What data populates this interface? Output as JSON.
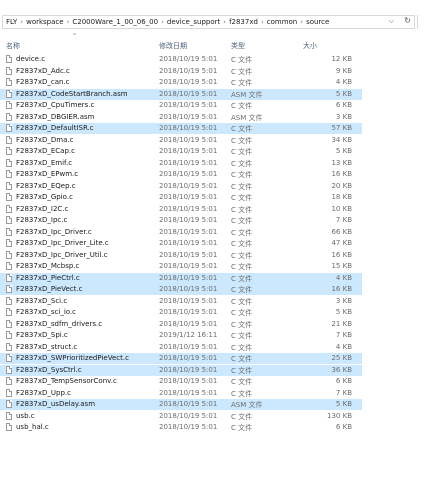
{
  "address": {
    "crumbs": [
      "FLY",
      "workspace",
      "C2000Ware_1_00_06_00",
      "device_support",
      "f2837xd",
      "common",
      "source"
    ],
    "dropdown_icon": "chevron-down-icon",
    "refresh_icon": "refresh-icon"
  },
  "columns": {
    "name": "名称",
    "date": "修改日期",
    "type": "类型",
    "size": "大小"
  },
  "files": [
    {
      "name": "device.c",
      "date": "2018/10/19 5:01",
      "type": "C 文件",
      "size": "12 KB",
      "selected": false
    },
    {
      "name": "F2837xD_Adc.c",
      "date": "2018/10/19 5:01",
      "type": "C 文件",
      "size": "9 KB",
      "selected": false
    },
    {
      "name": "F2837xD_can.c",
      "date": "2018/10/19 5:01",
      "type": "C 文件",
      "size": "4 KB",
      "selected": false
    },
    {
      "name": "F2837xD_CodeStartBranch.asm",
      "date": "2018/10/19 5:01",
      "type": "ASM 文件",
      "size": "5 KB",
      "selected": true
    },
    {
      "name": "F2837xD_CpuTimers.c",
      "date": "2018/10/19 5:01",
      "type": "C 文件",
      "size": "6 KB",
      "selected": false
    },
    {
      "name": "F2837xD_DBGIER.asm",
      "date": "2018/10/19 5:01",
      "type": "ASM 文件",
      "size": "3 KB",
      "selected": false
    },
    {
      "name": "F2837xD_DefaultISR.c",
      "date": "2018/10/19 5:01",
      "type": "C 文件",
      "size": "57 KB",
      "selected": true
    },
    {
      "name": "F2837xD_Dma.c",
      "date": "2018/10/19 5:01",
      "type": "C 文件",
      "size": "34 KB",
      "selected": false
    },
    {
      "name": "F2837xD_ECap.c",
      "date": "2018/10/19 5:01",
      "type": "C 文件",
      "size": "5 KB",
      "selected": false
    },
    {
      "name": "F2837xD_Emif.c",
      "date": "2018/10/19 5:01",
      "type": "C 文件",
      "size": "13 KB",
      "selected": false
    },
    {
      "name": "F2837xD_EPwm.c",
      "date": "2018/10/19 5:01",
      "type": "C 文件",
      "size": "16 KB",
      "selected": false
    },
    {
      "name": "F2837xD_EQep.c",
      "date": "2018/10/19 5:01",
      "type": "C 文件",
      "size": "20 KB",
      "selected": false
    },
    {
      "name": "F2837xD_Gpio.c",
      "date": "2018/10/19 5:01",
      "type": "C 文件",
      "size": "18 KB",
      "selected": false
    },
    {
      "name": "F2837xD_I2C.c",
      "date": "2018/10/19 5:01",
      "type": "C 文件",
      "size": "10 KB",
      "selected": false
    },
    {
      "name": "F2837xD_Ipc.c",
      "date": "2018/10/19 5:01",
      "type": "C 文件",
      "size": "7 KB",
      "selected": false
    },
    {
      "name": "F2837xD_Ipc_Driver.c",
      "date": "2018/10/19 5:01",
      "type": "C 文件",
      "size": "66 KB",
      "selected": false
    },
    {
      "name": "F2837xD_Ipc_Driver_Lite.c",
      "date": "2018/10/19 5:01",
      "type": "C 文件",
      "size": "47 KB",
      "selected": false
    },
    {
      "name": "F2837xD_Ipc_Driver_Util.c",
      "date": "2018/10/19 5:01",
      "type": "C 文件",
      "size": "16 KB",
      "selected": false
    },
    {
      "name": "F2837xD_Mcbsp.c",
      "date": "2018/10/19 5:01",
      "type": "C 文件",
      "size": "15 KB",
      "selected": false
    },
    {
      "name": "F2837xD_PieCtrl.c",
      "date": "2018/10/19 5:01",
      "type": "C 文件",
      "size": "4 KB",
      "selected": true
    },
    {
      "name": "F2837xD_PieVect.c",
      "date": "2018/10/19 5:01",
      "type": "C 文件",
      "size": "16 KB",
      "selected": true
    },
    {
      "name": "F2837xD_Sci.c",
      "date": "2018/10/19 5:01",
      "type": "C 文件",
      "size": "3 KB",
      "selected": false
    },
    {
      "name": "F2837xD_sci_io.c",
      "date": "2018/10/19 5:01",
      "type": "C 文件",
      "size": "5 KB",
      "selected": false
    },
    {
      "name": "F2837xD_sdfm_drivers.c",
      "date": "2018/10/19 5:01",
      "type": "C 文件",
      "size": "21 KB",
      "selected": false
    },
    {
      "name": "F2837xD_Spi.c",
      "date": "2019/1/12 16:11",
      "type": "C 文件",
      "size": "7 KB",
      "selected": false
    },
    {
      "name": "F2837xD_struct.c",
      "date": "2018/10/19 5:01",
      "type": "C 文件",
      "size": "4 KB",
      "selected": false
    },
    {
      "name": "F2837xD_SWPrioritizedPieVect.c",
      "date": "2018/10/19 5:01",
      "type": "C 文件",
      "size": "25 KB",
      "selected": true
    },
    {
      "name": "F2837xD_SysCtrl.c",
      "date": "2018/10/19 5:01",
      "type": "C 文件",
      "size": "36 KB",
      "selected": true
    },
    {
      "name": "F2837xD_TempSensorConv.c",
      "date": "2018/10/19 5:01",
      "type": "C 文件",
      "size": "6 KB",
      "selected": false
    },
    {
      "name": "F2837xD_Upp.c",
      "date": "2018/10/19 5:01",
      "type": "C 文件",
      "size": "7 KB",
      "selected": false
    },
    {
      "name": "F2837xD_usDelay.asm",
      "date": "2018/10/19 5:01",
      "type": "ASM 文件",
      "size": "5 KB",
      "selected": true
    },
    {
      "name": "usb.c",
      "date": "2018/10/19 5:01",
      "type": "C 文件",
      "size": "130 KB",
      "selected": false
    },
    {
      "name": "usb_hal.c",
      "date": "2018/10/19 5:01",
      "type": "C 文件",
      "size": "6 KB",
      "selected": false
    }
  ]
}
